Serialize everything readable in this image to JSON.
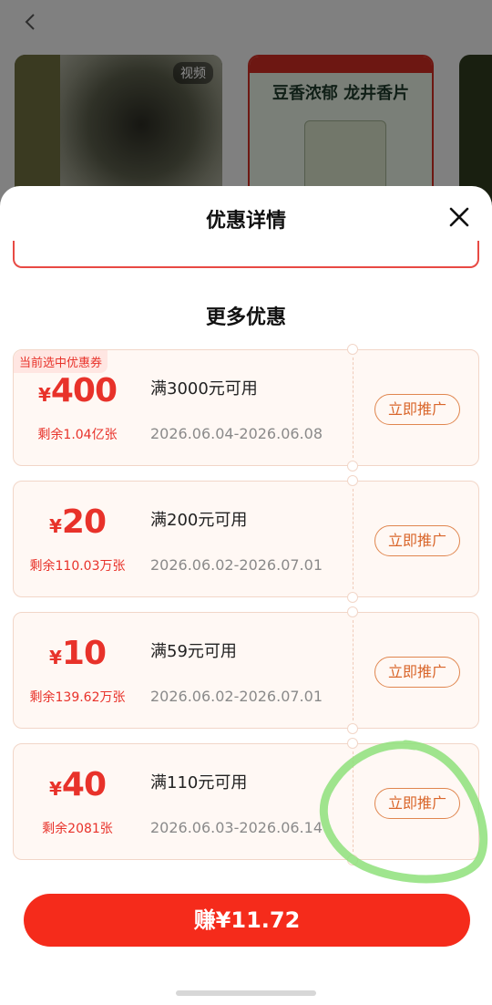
{
  "background": {
    "video_badge": "视频",
    "product_title": "豆香浓郁 龙井香片"
  },
  "sheet": {
    "title": "优惠详情",
    "section_title": "更多优惠",
    "selected_tag": "当前选中优惠券",
    "currency": "¥",
    "promote_label": "立即推广",
    "coupons": [
      {
        "amount": "400",
        "remain": "剩余1.04亿张",
        "condition": "满3000元可用",
        "dates": "2026.06.04-2026.06.08"
      },
      {
        "amount": "20",
        "remain": "剩余110.03万张",
        "condition": "满200元可用",
        "dates": "2026.06.02-2026.07.01"
      },
      {
        "amount": "10",
        "remain": "剩余139.62万张",
        "condition": "满59元可用",
        "dates": "2026.06.02-2026.07.01"
      },
      {
        "amount": "40",
        "remain": "剩余2081张",
        "condition": "满110元可用",
        "dates": "2026.06.03-2026.06.14"
      }
    ],
    "earn_button": "赚¥11.72"
  },
  "colors": {
    "accent_red": "#f52b1b",
    "coupon_red": "#e8322a",
    "promote_orange": "#d9662b",
    "annotation_green": "#8ee07a"
  }
}
